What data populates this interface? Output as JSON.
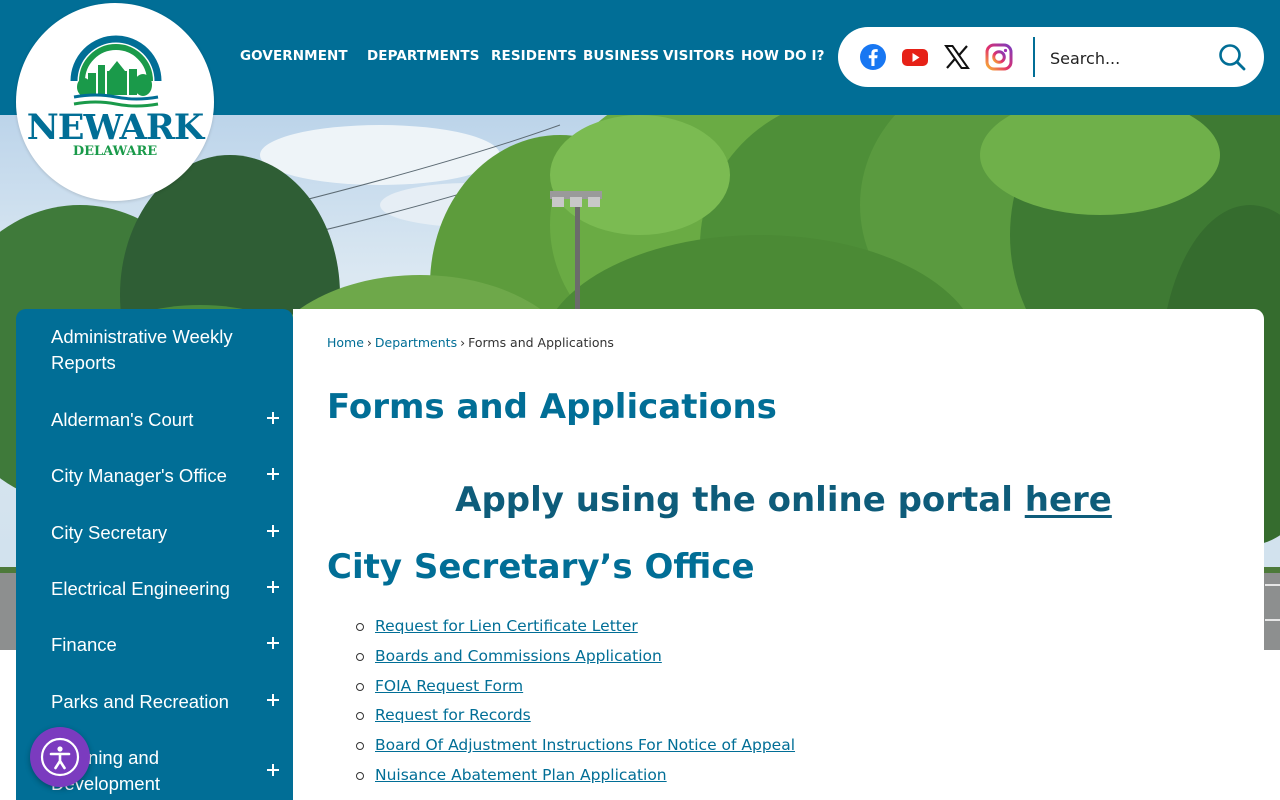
{
  "logo": {
    "line1": "NEWARK",
    "line2": "DELAWARE"
  },
  "nav": {
    "items": [
      "GOVERNMENT",
      "DEPARTMENTS",
      "RESIDENTS",
      "BUSINESS",
      "VISITORS",
      "HOW DO I?"
    ]
  },
  "social": {
    "icons": [
      "facebook-icon",
      "youtube-icon",
      "x-icon",
      "instagram-icon"
    ]
  },
  "search": {
    "placeholder": "Search..."
  },
  "sidebar": {
    "items": [
      {
        "label": "Administrative Weekly Reports",
        "expandable": false
      },
      {
        "label": "Alderman's Court",
        "expandable": true
      },
      {
        "label": "City Manager's Office",
        "expandable": true
      },
      {
        "label": "City Secretary",
        "expandable": true
      },
      {
        "label": "Electrical Engineering",
        "expandable": true
      },
      {
        "label": "Finance",
        "expandable": true
      },
      {
        "label": "Parks and Recreation",
        "expandable": true
      },
      {
        "label": "Planning and Development",
        "expandable": true
      }
    ]
  },
  "breadcrumb": {
    "home": "Home",
    "departments": "Departments",
    "current": "Forms and Applications",
    "separator": "›"
  },
  "main": {
    "title": "Forms and Applications",
    "portal_text": "Apply using the online portal ",
    "portal_link": "here",
    "section_title": "City Secretary’s Office",
    "links": [
      "Request for Lien Certificate Letter",
      "Boards and Commissions Application",
      "FOIA Request Form",
      "Request for Records",
      "Board Of Adjustment Instructions For Notice of Appeal",
      "Nuisance Abatement Plan Application"
    ]
  },
  "colors": {
    "brand": "#016e96",
    "link": "#016e96",
    "accessibility": "#7b3bbf"
  }
}
